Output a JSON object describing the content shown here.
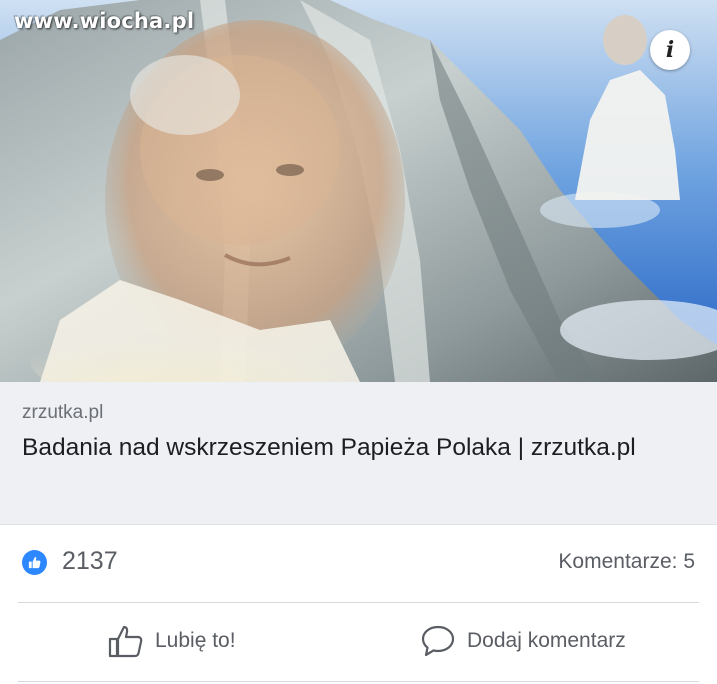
{
  "watermark": "www.wiocha.pl",
  "link_preview": {
    "domain": "zrzutka.pl",
    "title": "Badania nad wskrzeszeniem Papieża Polaka | zrzutka.pl",
    "info_icon": "info-icon"
  },
  "stats": {
    "reaction_icon": "like-icon",
    "like_count": "2137",
    "comments_label": "Komentarze: 5"
  },
  "actions": {
    "like_label": "Lubię to!",
    "like_icon": "thumbs-up-outline-icon",
    "comment_label": "Dodaj komentarz",
    "comment_icon": "speech-bubble-icon"
  },
  "colors": {
    "accent": "#2d88ff",
    "text_secondary": "#5a5e64",
    "title_text": "#1c1e21",
    "preview_background": "#eef0f3"
  }
}
